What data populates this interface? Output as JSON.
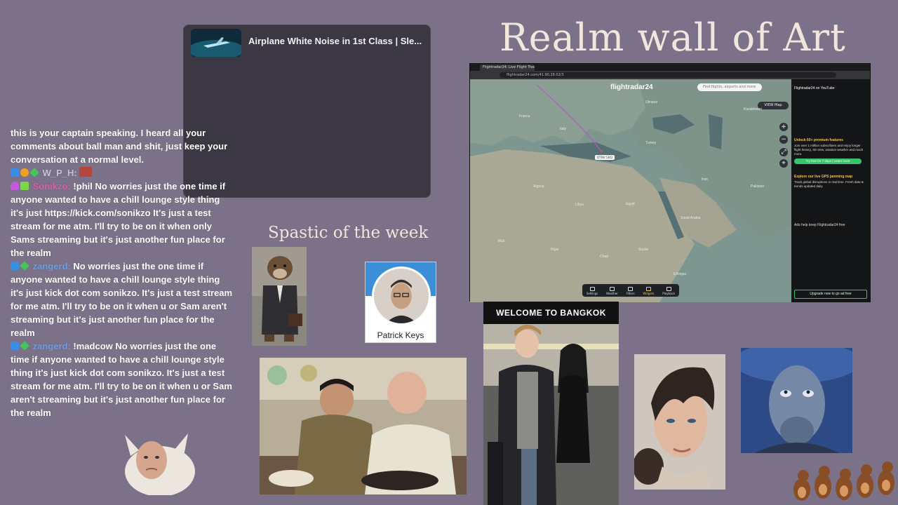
{
  "now_playing": {
    "title": "Airplane White Noise in 1st Class | Sle..."
  },
  "headings": {
    "wall": "Realm wall of Art",
    "spastic": "Spastic of the week"
  },
  "chat": [
    {
      "user": "",
      "badges": [],
      "text": "this is your captain speaking. I heard all your comments about ball man and shit, just keep your conversation at a normal level."
    },
    {
      "user": "W_P_H:",
      "user_color": "#c8c4d8",
      "badges": [
        "blue",
        "orange",
        "green"
      ],
      "text": "",
      "emote": "red"
    },
    {
      "user": "Sonikzo:",
      "user_color": "#e05fae",
      "badges": [
        "mic",
        "lime"
      ],
      "text": "!phil No worries just the one time if anyone wanted to have a chill lounge style thing it's just https://kick.com/sonikzo It's just a test stream for me atm. I'll try to be on it when only Sams streaming but it's just another fun place for the realm"
    },
    {
      "user": "zangerd:",
      "user_color": "#6fa0e6",
      "badges": [
        "blue",
        "green"
      ],
      "text": "No worries just the one time if anyone wanted to have a chill lounge style thing it's just kick dot com sonikzo. It's just a test stream for me atm. I'll try to be on it when u or Sam aren't streaming but it's just another fun place for the realm"
    },
    {
      "user": "zangerd:",
      "user_color": "#6fa0e6",
      "badges": [
        "blue",
        "green"
      ],
      "text": "!madcow No worries just the one time if anyone wanted to have a chill lounge style thing it's just kick dot com sonikzo. It's just a test stream for me atm. I'll try to be on it when u or Sam aren't streaming but it's just another fun place for the realm"
    }
  ],
  "browser": {
    "tab_title": "Flightradar24: Live Flight Tracker",
    "url": "flightradar24.com/41.90,28.02/3",
    "logo": "flightradar24",
    "search_placeholder": "Find flights, airports and more",
    "view_label": "VIEW  Map",
    "toolbar": [
      {
        "label": "Settings",
        "active": false
      },
      {
        "label": "Weather",
        "active": false
      },
      {
        "label": "Filters",
        "active": false
      },
      {
        "label": "Widgets",
        "active": true
      },
      {
        "label": "Playback",
        "active": false
      }
    ],
    "plane_tag": "QTR8 5342",
    "map_labels": [
      {
        "name": "France"
      },
      {
        "name": "Italy"
      },
      {
        "name": "Ukraine"
      },
      {
        "name": "Turkey"
      },
      {
        "name": "Algeria"
      },
      {
        "name": "Libya"
      },
      {
        "name": "Egypt"
      },
      {
        "name": "Iran"
      },
      {
        "name": "Saudi Arabia"
      },
      {
        "name": "Niger"
      },
      {
        "name": "Sudan"
      },
      {
        "name": "Kazakhstan"
      },
      {
        "name": "Mali"
      },
      {
        "name": "Chad"
      },
      {
        "name": "Ethiopia"
      },
      {
        "name": "Pakistan"
      }
    ],
    "side_panel": {
      "top": "Flightradar24 on YouTube",
      "premium_head": "Unlock 60+ premium features",
      "premium_body": "Join over 1 million subscribers and enjoy longer flight history, 3D view, aviation weather and much more.",
      "premium_button": "Try free for 7 days | Learn more",
      "gps_head": "Explore our live GPS jamming map",
      "gps_body": "Track global disruptions in real time. Fresh data & trends updated daily.",
      "ads": "Ads help keep Flightradar24 free",
      "upgrade": "Upgrade now to go ad free"
    }
  },
  "profile": {
    "name": "Patrick Keys"
  },
  "bangkok": {
    "banner": "WELCOME TO BANGKOK"
  }
}
